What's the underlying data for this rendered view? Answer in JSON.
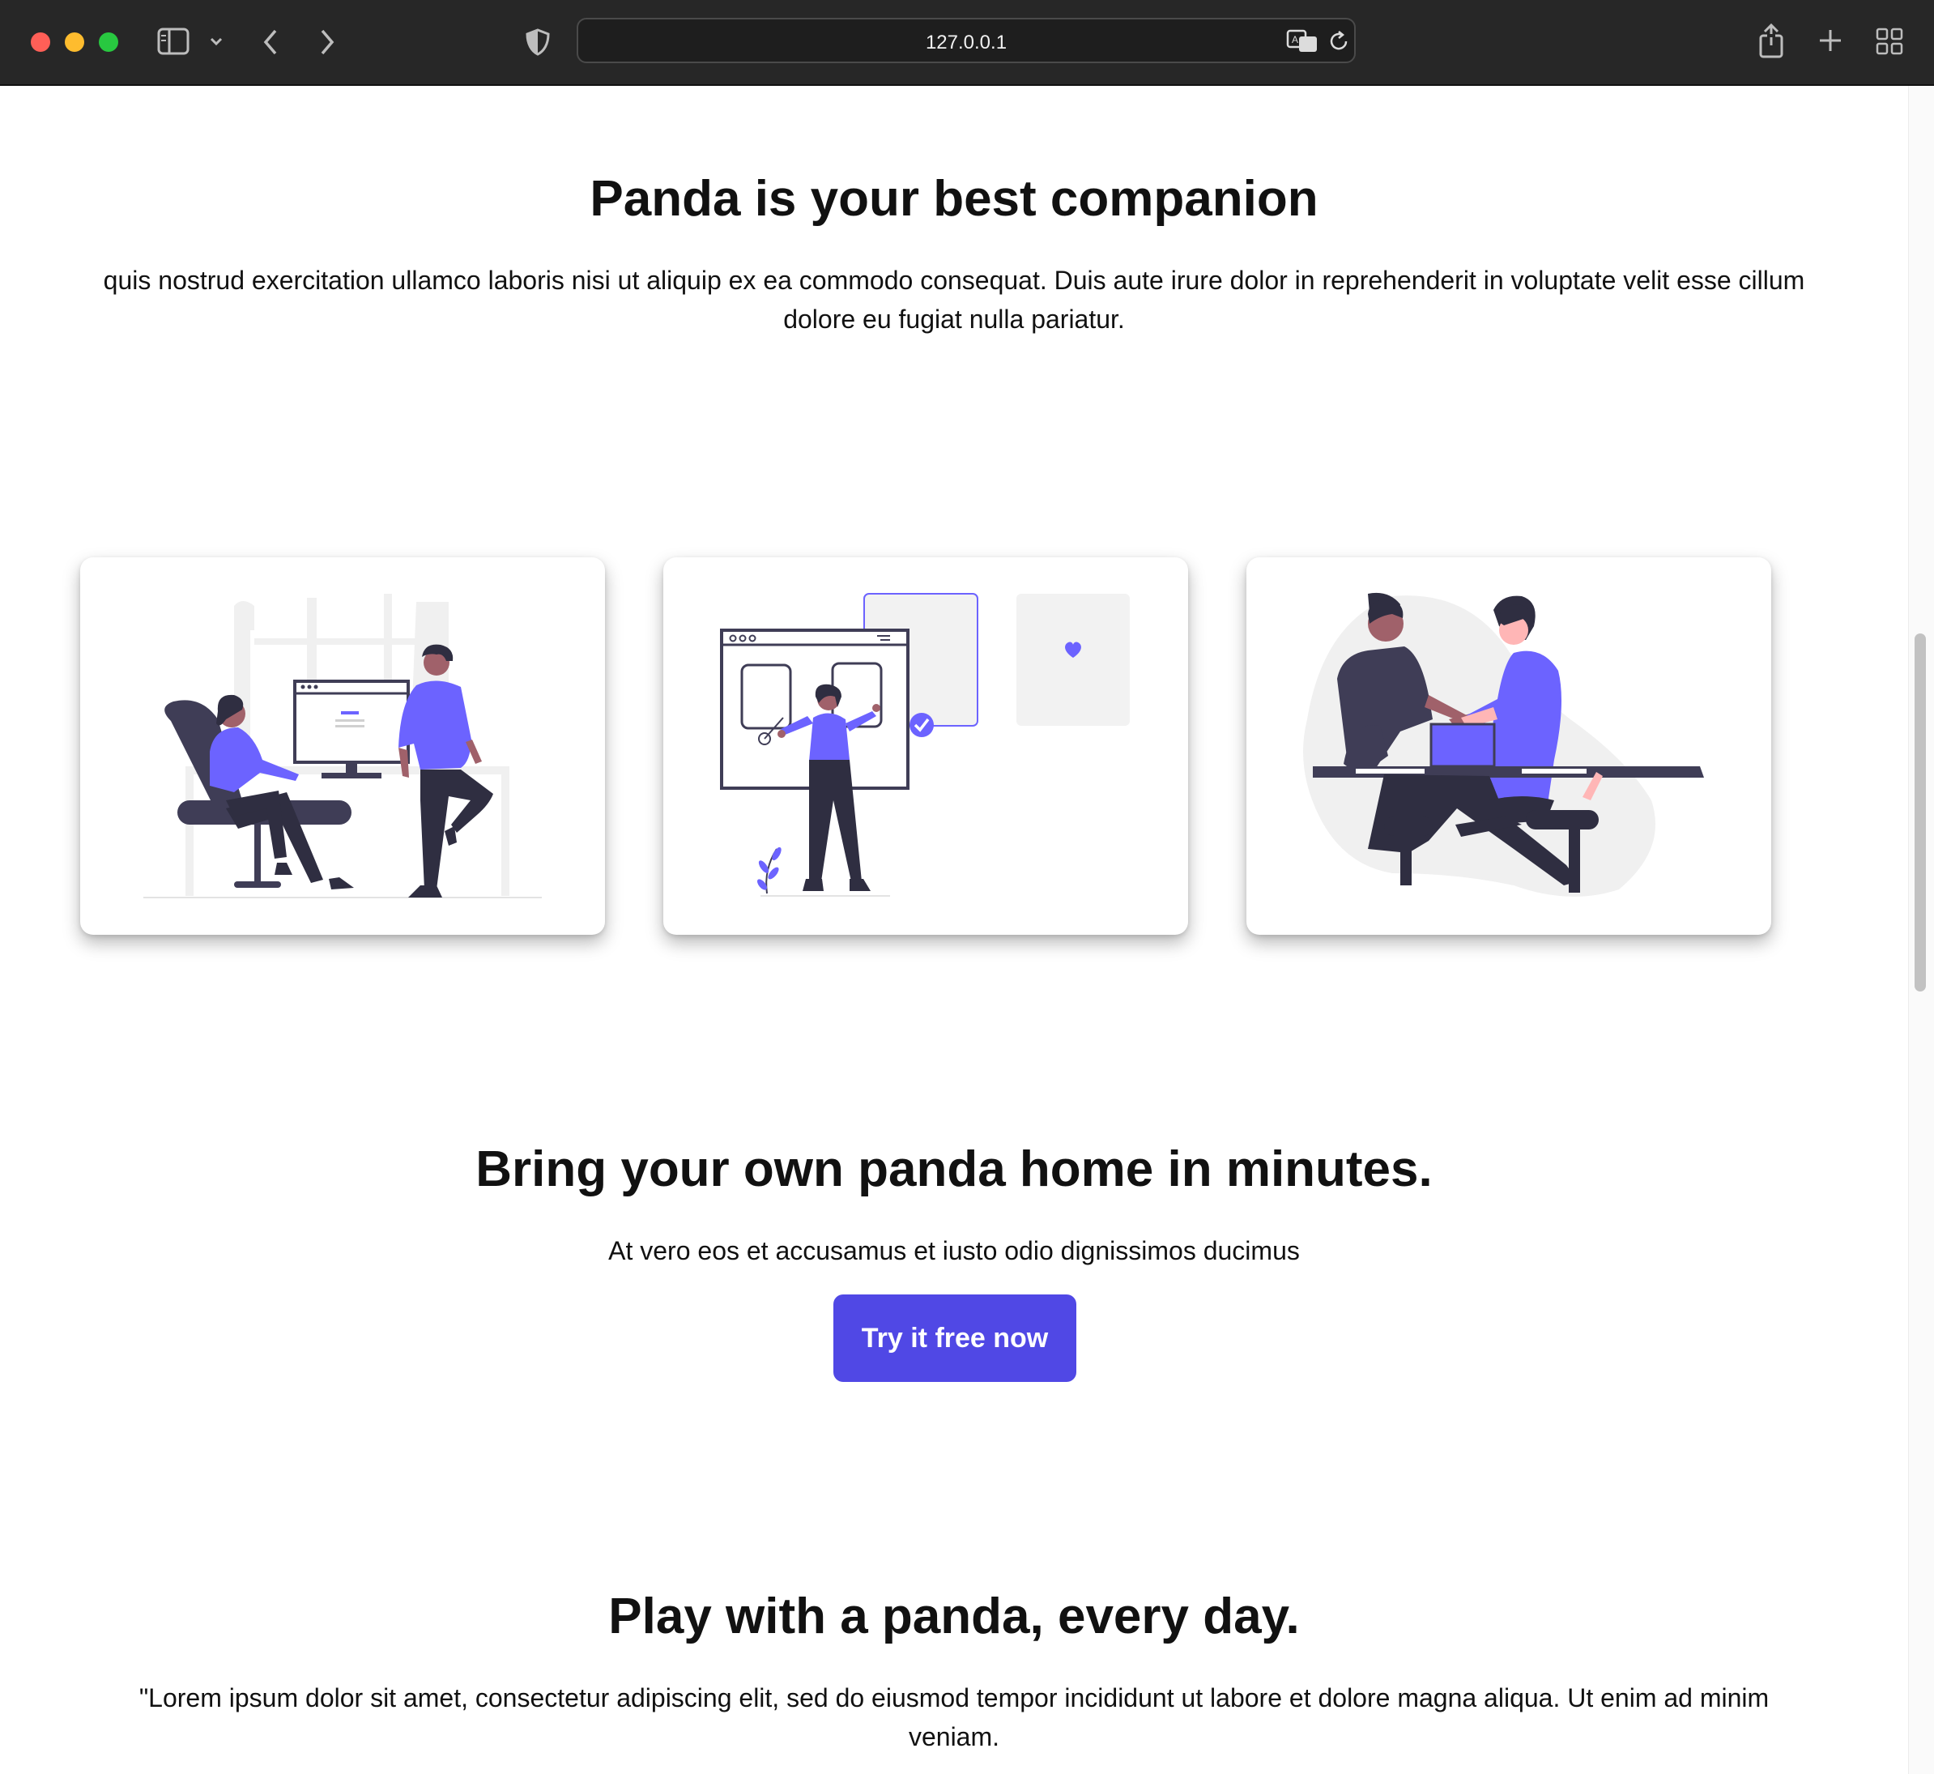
{
  "browser": {
    "url": "127.0.0.1",
    "traffic_light_colors": [
      "#ff5f57",
      "#febc2e",
      "#28c840"
    ]
  },
  "section_companion": {
    "title": "Panda is your best companion",
    "text": "quis nostrud exercitation ullamco laboris nisi ut aliquip ex ea commodo consequat. Duis aute irure dolor in reprehenderit in voluptate velit esse cillum dolore eu fugiat nulla pariatur."
  },
  "illustrations": [
    "people-at-workstation-illustration",
    "person-drawing-wireframe-illustration",
    "handshake-meeting-illustration"
  ],
  "section_cta": {
    "title": "Bring your own panda home in minutes.",
    "text": "At vero eos et accusamus et iusto odio dignissimos ducimus",
    "button_label": "Try it free now"
  },
  "section_play": {
    "title": "Play with a panda, every day.",
    "text": "\"Lorem ipsum dolor sit amet, consectetur adipiscing elit, sed do eiusmod tempor incididunt ut labore et dolore magna aliqua. Ut enim ad minim veniam."
  },
  "colors": {
    "accent": "#5048e5",
    "illustration_purple": "#6c63ff",
    "illustration_dark": "#3f3d56",
    "text": "#111111"
  }
}
